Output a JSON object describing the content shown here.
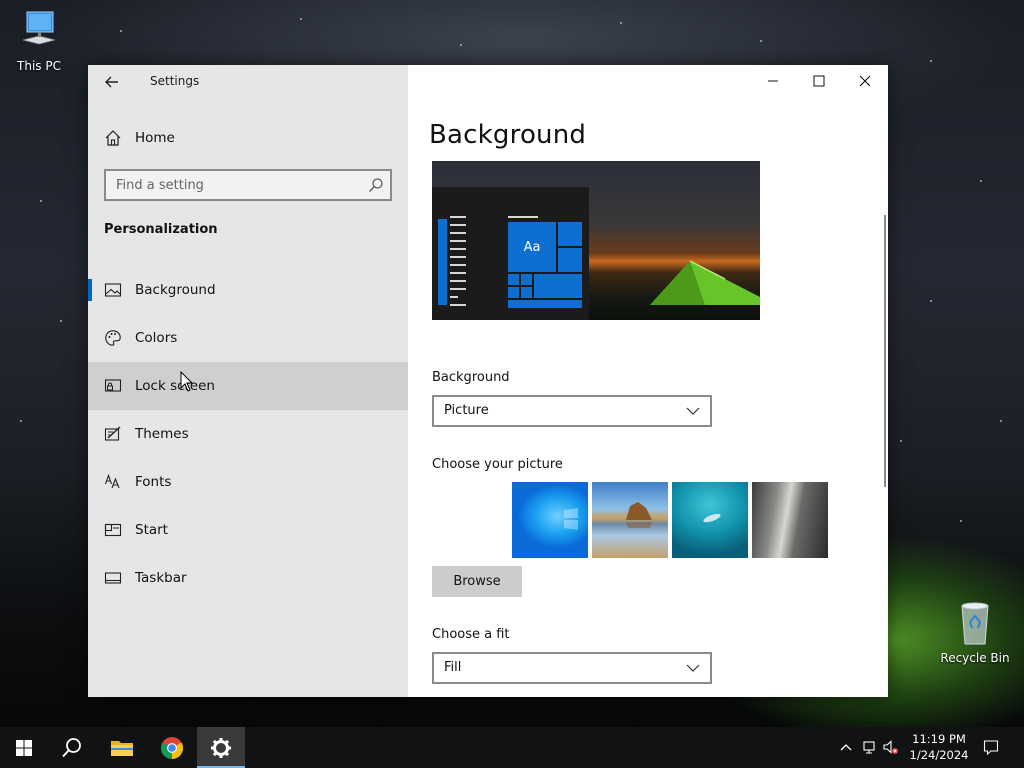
{
  "desktop": {
    "icons": [
      {
        "label": "This PC",
        "icon": "computer-icon"
      },
      {
        "label": "Recycle Bin",
        "icon": "recycle-bin-icon"
      }
    ]
  },
  "window": {
    "title": "Settings",
    "home_label": "Home",
    "search_placeholder": "Find a setting",
    "section_title": "Personalization",
    "nav_items": [
      {
        "label": "Background",
        "icon": "picture-icon",
        "selected": true
      },
      {
        "label": "Colors",
        "icon": "palette-icon"
      },
      {
        "label": "Lock screen",
        "icon": "lock-screen-icon"
      },
      {
        "label": "Themes",
        "icon": "themes-icon"
      },
      {
        "label": "Fonts",
        "icon": "fonts-icon"
      },
      {
        "label": "Start",
        "icon": "start-icon"
      },
      {
        "label": "Taskbar",
        "icon": "taskbar-icon"
      }
    ]
  },
  "content": {
    "page_title": "Background",
    "preview_tile_text": "Aa",
    "background_label": "Background",
    "background_value": "Picture",
    "choose_picture_label": "Choose your picture",
    "browse_label": "Browse",
    "choose_fit_label": "Choose a fit",
    "fit_value": "Fill"
  },
  "taskbar": {
    "time": "11:19 PM",
    "date": "1/24/2024",
    "accent_color": "#76b9ed"
  },
  "colors": {
    "accent": "#0067c0",
    "tile_blue": "#0c6fd1",
    "nav_background": "#e6e6e6"
  }
}
